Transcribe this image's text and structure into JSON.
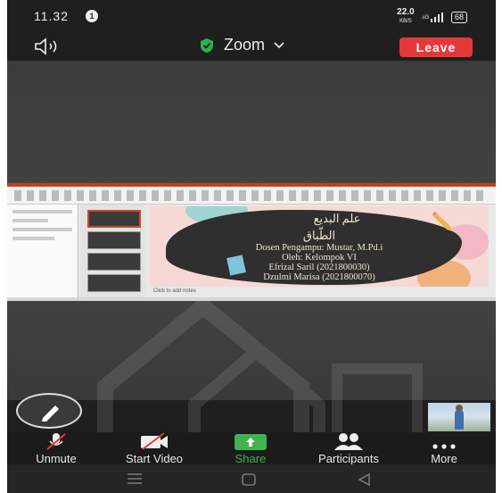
{
  "status_bar": {
    "time": "11.32",
    "notification_count": "1",
    "network_speed": "22.0",
    "network_unit": "KB/S",
    "signal_text": "⁴ᴳ",
    "battery": "68"
  },
  "header": {
    "meeting_title": "Zoom",
    "leave_label": "Leave"
  },
  "shared_slide": {
    "arabic_line1": "علم البديع",
    "arabic_line2": "الطّباق",
    "line1": "Dosen Pengampu: Mustar, M.Pd.i",
    "line2": "Oleh: Kelompok VI",
    "line3": "Efrizal Saril (2021800030)",
    "line4": "Dzulmi Marisa (2021800070)",
    "notes_placeholder": "Click to add notes"
  },
  "toolbar": {
    "unmute": "Unmute",
    "start_video": "Start Video",
    "share": "Share",
    "participants": "Participants",
    "more": "More"
  },
  "colors": {
    "leave": "#e5383b",
    "share_active": "#3fb34f",
    "shield": "#2bb24c"
  }
}
